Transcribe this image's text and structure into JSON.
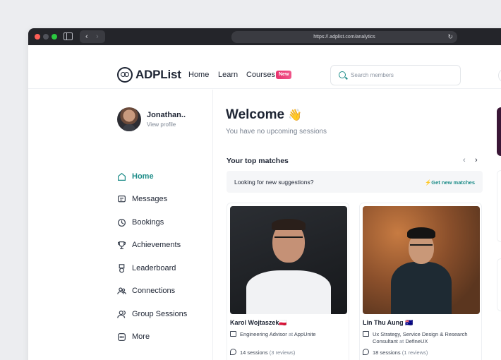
{
  "browser": {
    "url": "https://.adplist.com/analytics"
  },
  "header": {
    "logo": "ADPList",
    "nav": [
      "Home",
      "Learn",
      "Courses"
    ],
    "courses_badge": "New",
    "search_placeholder": "Search members"
  },
  "profile": {
    "name": "Jonathan..",
    "link": "View profile"
  },
  "sidebar": {
    "items": [
      {
        "label": "Home",
        "icon": "home-icon",
        "active": true
      },
      {
        "label": "Messages",
        "icon": "message-icon",
        "active": false
      },
      {
        "label": "Bookings",
        "icon": "clock-icon",
        "active": false
      },
      {
        "label": "Achievements",
        "icon": "trophy-icon",
        "active": false
      },
      {
        "label": "Leaderboard",
        "icon": "medal-icon",
        "active": false
      },
      {
        "label": "Connections",
        "icon": "people-icon",
        "active": false
      },
      {
        "label": "Group Sessions",
        "icon": "group-icon",
        "active": false
      },
      {
        "label": "More",
        "icon": "more-icon",
        "active": false
      }
    ]
  },
  "main": {
    "welcome": "Welcome",
    "welcome_emoji": "👋",
    "subtitle": "You have no upcoming sessions",
    "section_title": "Your top matches",
    "suggestion_text": "Looking for new suggestions?",
    "suggestion_link": "Get new matches",
    "cards": [
      {
        "name": "Karol Wojtaszek",
        "flag": "🇵🇱",
        "role": "Engineering Advisor",
        "at": "at",
        "company": "AppUnite",
        "sessions": "14 sessions",
        "reviews": "(3 reviews)"
      },
      {
        "name": "Lin Thu Aung",
        "flag": "🇦🇺",
        "role": "Ux Strategy, Service Design & Research Consultant",
        "at": "at",
        "company": "DefineUX",
        "sessions": "18 sessions",
        "reviews": "(1 reviews)"
      }
    ]
  },
  "colors": {
    "accent": "#1d8c88",
    "badge": "#e8326e"
  }
}
